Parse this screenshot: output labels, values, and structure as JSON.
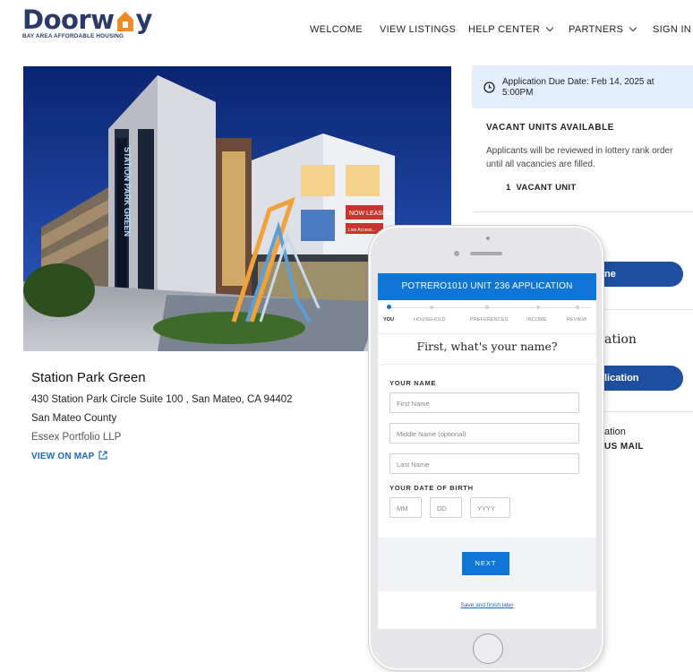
{
  "brand": {
    "name_left": "Doorw",
    "name_right": "y",
    "tagline": "BAY AREA AFFORDABLE HOUSING",
    "colors": {
      "navy": "#2b3a67",
      "orange": "#f08a24",
      "blue": "#0f76d6"
    }
  },
  "nav": {
    "welcome": "WELCOME",
    "view_listings": "VIEW LISTINGS",
    "help_center": "HELP CENTER",
    "partners": "PARTNERS",
    "sign_in": "SIGN IN"
  },
  "hero": {
    "sign_vertical": "STATION PARK GREEN",
    "banner_now_leasing": "NOW LEASING",
    "banner_sub": "Live Access..."
  },
  "property": {
    "name": "Station Park Green",
    "address": "430 Station Park Circle Suite 100 , San Mateo, CA 94402",
    "county": "San Mateo County",
    "developer": "Essex Portfolio LLP",
    "map_link": "VIEW ON MAP"
  },
  "sidebar": {
    "due_date": "Application Due Date: Feb 14, 2025 at 5:00PM",
    "vacant_title": "VACANT UNITS AVAILABLE",
    "vacant_desc": "Applicants will be reviewed in lottery rank order until all vacancies are filled.",
    "vacant_count_num": "1",
    "vacant_count_label": "VACANT UNIT",
    "btn1_partial": "ne",
    "heading_partial": "ation",
    "btn2_partial": "lication",
    "mail_line1_partial": "ation",
    "mail_line2_partial": "US MAIL"
  },
  "phone": {
    "header": "POTRERO1010 UNIT 236 APPLICATION",
    "steps": [
      "YOU",
      "HOUSEHOLD",
      "PREFERENCES",
      "INCOME",
      "REVIEW"
    ],
    "question": "First, what's your name?",
    "name_label": "YOUR NAME",
    "first_placeholder": "First Name",
    "middle_placeholder": "Middle Name (optional)",
    "last_placeholder": "Last Name",
    "dob_label": "YOUR DATE OF BIRTH",
    "dob_mm": "MM",
    "dob_dd": "DD",
    "dob_yyyy": "YYYY",
    "next_button": "NEXT",
    "save_link": "Save and finish later"
  }
}
